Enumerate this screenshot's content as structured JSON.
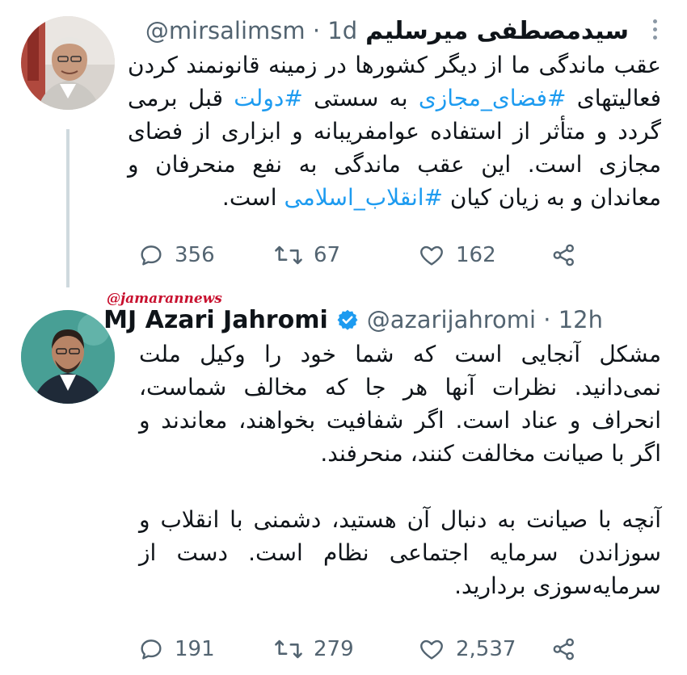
{
  "tweets": [
    {
      "display_name": "سیدمصطفی میرسلیم",
      "handle_time": "@mirsalimsm · 1d",
      "paragraphs": [
        [
          {
            "text": "عقب ماندگی ما از دیگر کشورها در زمینه قانونمند کردن فعالیتهای ",
            "hashtag": false
          },
          {
            "text": "#فضای_مجازی",
            "hashtag": true
          },
          {
            "text": " به سستی ",
            "hashtag": false
          },
          {
            "text": "#دولت",
            "hashtag": true
          },
          {
            "text": " قبل برمی گردد و متأثر از استفاده عوامفریبانه و ابزاری از فضای مجازی است. این عقب ماندگی به نفع منحرفان و معاندان و به زیان کیان ",
            "hashtag": false
          },
          {
            "text": "#انقلاب_اسلامی",
            "hashtag": true
          },
          {
            "text": " است.",
            "hashtag": false
          }
        ]
      ],
      "replies": "356",
      "retweets": "67",
      "likes": "162"
    },
    {
      "display_name": "MJ Azari Jahromi",
      "handle_time": "@azarijahromi · 12h",
      "verified": true,
      "paragraphs": [
        [
          {
            "text": "مشکل آنجایی است که شما خود را وکیل ملت نمی‌دانید. نظرات آنها هر جا که مخالف شماست، انحراف و عناد است. اگر شفافیت بخواهند، معاندند و اگر با صیانت مخالفت کنند، منحرفند.",
            "hashtag": false
          }
        ],
        [
          {
            "text": "آنچه با صیانت به دنبال آن هستید، دشمنی با انقلاب و سوزاندن سرمایه اجتماعی نظام است. دست از سرمایه‌سوزی بردارید.",
            "hashtag": false
          }
        ]
      ],
      "replies": "191",
      "retweets": "279",
      "likes": "2,537"
    }
  ],
  "watermark": "@jamarannews",
  "colors": {
    "text": "#0f1419",
    "secondary": "#536471",
    "hashtag": "#1d9bf0",
    "verified": "#1d9bf0",
    "watermark": "#c8102e"
  },
  "icons": [
    "reply-icon",
    "retweet-icon",
    "like-icon",
    "share-icon",
    "verified-badge-icon",
    "more-icon"
  ]
}
